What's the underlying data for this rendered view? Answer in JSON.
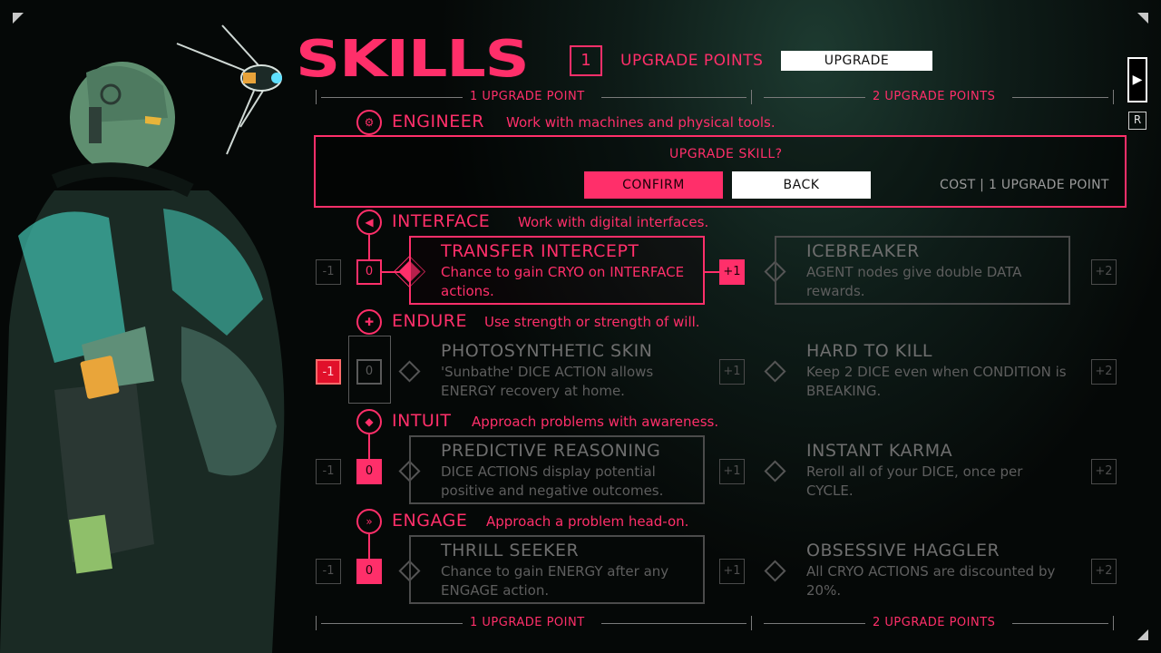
{
  "header": {
    "title": "SKILLS",
    "upgrade_points_value": "1",
    "upgrade_points_label": "UPGRADE POINTS",
    "upgrade_button": "UPGRADE"
  },
  "side": {
    "play_glyph": "▶",
    "r_key": "R"
  },
  "dividers": {
    "left_label": "1 UPGRADE POINT",
    "right_label": "2 UPGRADE POINTS"
  },
  "dialog": {
    "question": "UPGRADE SKILL?",
    "confirm": "CONFIRM",
    "back": "BACK",
    "cost": "COST | 1 UPGRADE POINT"
  },
  "categories": [
    {
      "name": "ENGINEER",
      "description": "Work with machines and physical tools.",
      "icon": "gear-icon"
    },
    {
      "name": "INTERFACE",
      "description": "Work with digital interfaces.",
      "icon": "interface-icon",
      "level": "0",
      "minus": "-1",
      "plus1": "+1",
      "plus2": "+2",
      "skill1": {
        "name": "TRANSFER INTERCEPT",
        "description": "Chance to gain CRYO on INTERFACE actions."
      },
      "skill2": {
        "name": "ICEBREAKER",
        "description": "AGENT nodes give double DATA rewards."
      }
    },
    {
      "name": "ENDURE",
      "description": "Use strength or strength of will.",
      "icon": "endure-icon",
      "level": "0",
      "minus": "-1",
      "plus1": "+1",
      "plus2": "+2",
      "skill1": {
        "name": "PHOTOSYNTHETIC SKIN",
        "description": "'Sunbathe' DICE ACTION allows ENERGY recovery at home."
      },
      "skill2": {
        "name": "HARD TO KILL",
        "description": "Keep 2 DICE even when CONDITION is BREAKING."
      }
    },
    {
      "name": "INTUIT",
      "description": "Approach problems with awareness.",
      "icon": "intuit-icon",
      "level": "0",
      "minus": "-1",
      "plus1": "+1",
      "plus2": "+2",
      "skill1": {
        "name": "PREDICTIVE REASONING",
        "description": "DICE ACTIONS display potential positive and negative outcomes."
      },
      "skill2": {
        "name": "INSTANT KARMA",
        "description": "Reroll all of your DICE, once per CYCLE."
      }
    },
    {
      "name": "ENGAGE",
      "description": "Approach a problem head-on.",
      "icon": "engage-icon",
      "level": "0",
      "minus": "-1",
      "plus1": "+1",
      "plus2": "+2",
      "skill1": {
        "name": "THRILL SEEKER",
        "description": "Chance to gain ENERGY after any ENGAGE action."
      },
      "skill2": {
        "name": "OBSESSIVE HAGGLER",
        "description": "All CRYO ACTIONS are discounted by 20%."
      }
    }
  ],
  "colors": {
    "accent": "#ff2f6a",
    "background": "#050807",
    "muted": "#6e6e6e",
    "alert_red": "#e1102a"
  }
}
